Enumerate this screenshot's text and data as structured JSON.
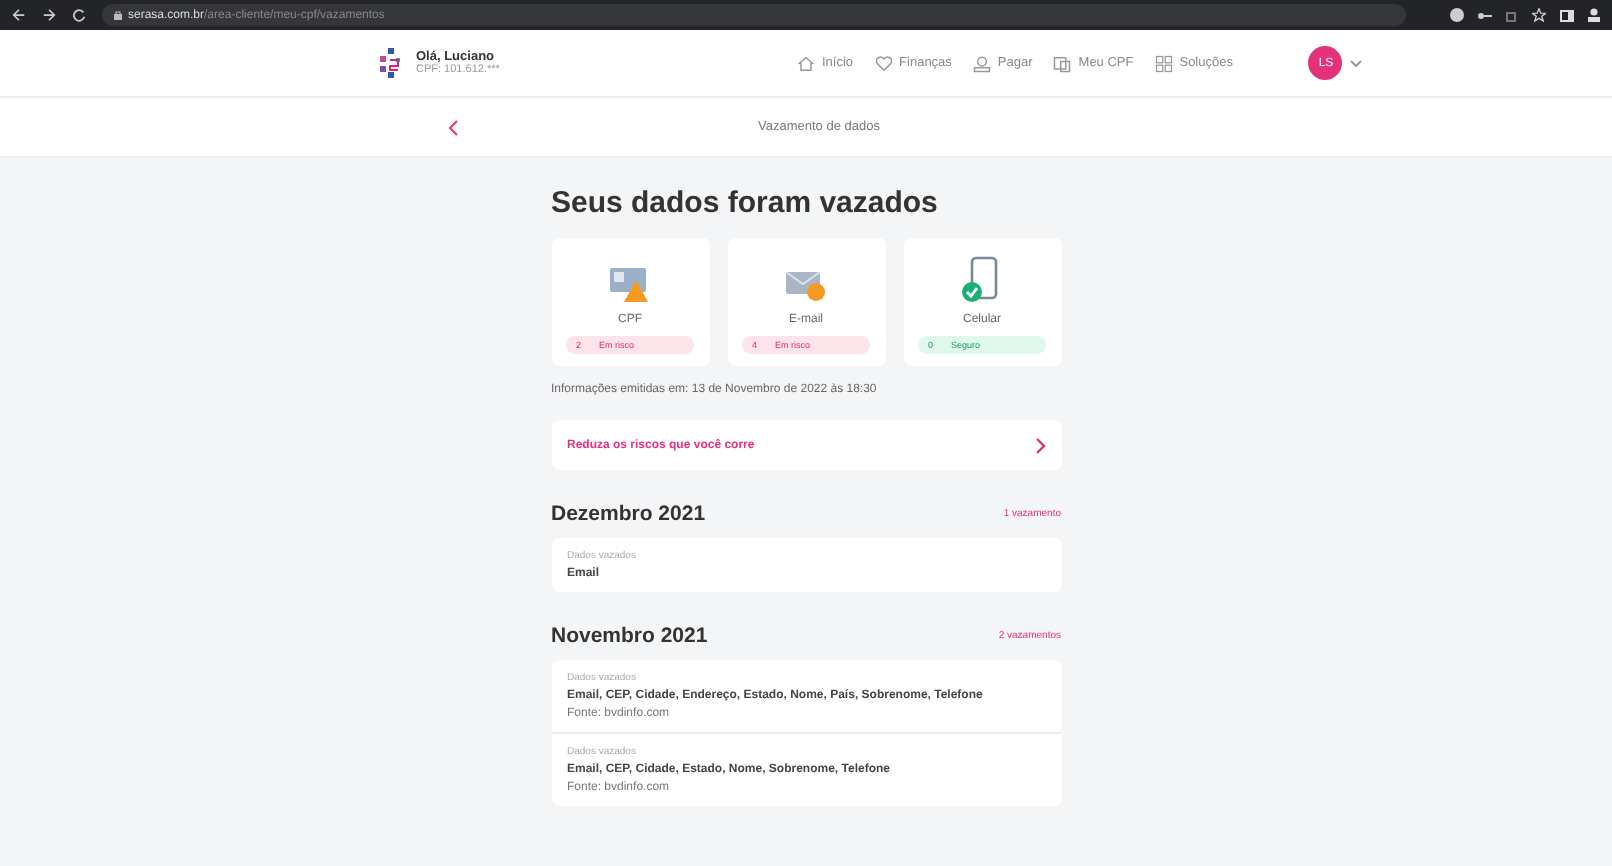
{
  "browser": {
    "url_host": "serasa.com.br",
    "url_path": "/area-cliente/meu-cpf/vazamentos"
  },
  "header": {
    "greeting": "Olá, Luciano",
    "cpf": "CPF: 101.612.***",
    "nav": [
      {
        "label": "Início",
        "kind": "home"
      },
      {
        "label": "Finanças",
        "kind": "heart"
      },
      {
        "label": "Pagar",
        "kind": "pay"
      },
      {
        "label": "Meu CPF",
        "kind": "cpf"
      },
      {
        "label": "Soluções",
        "kind": "grid"
      }
    ],
    "avatar": "LS"
  },
  "subheader": {
    "title": "Vazamento de dados"
  },
  "title": "Seus dados foram vazados",
  "cards": [
    {
      "label": "CPF",
      "kind": "cpf",
      "count": "2",
      "status": "Em risco",
      "safe": false
    },
    {
      "label": "E-mail",
      "kind": "email",
      "count": "4",
      "status": "Em risco",
      "safe": false
    },
    {
      "label": "Celular",
      "kind": "phone",
      "count": "0",
      "status": "Seguro",
      "safe": true
    }
  ],
  "info": "Informações emitidas em: 13 de Novembro de 2022 às 18:30",
  "reduce_link": "Reduza os riscos que você corre",
  "months": [
    {
      "title": "Dezembro 2021",
      "count": "1 vazamento",
      "entries": [
        {
          "label": "Dados vazados",
          "data": "Email"
        }
      ]
    },
    {
      "title": "Novembro 2021",
      "count": "2 vazamentos",
      "entries": [
        {
          "label": "Dados vazados",
          "data": "Email, CEP, Cidade, Endereço, Estado, Nome, País, Sobrenome, Telefone",
          "source": "Fonte: bvdinfo.com"
        },
        {
          "label": "Dados vazados",
          "data": "Email, CEP, Cidade, Estado, Nome, Sobrenome, Telefone",
          "source": "Fonte: bvdinfo.com"
        }
      ]
    }
  ]
}
